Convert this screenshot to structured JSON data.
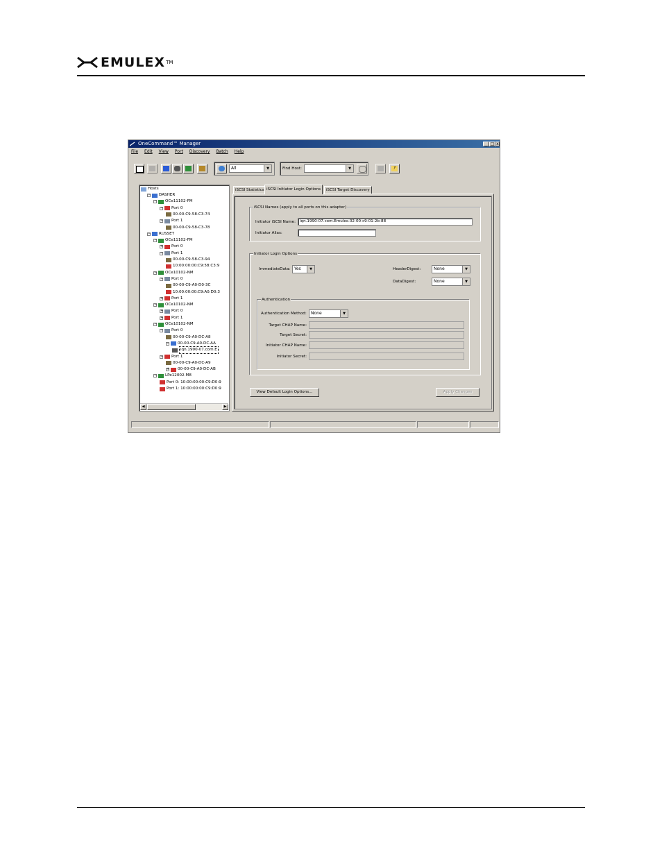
{
  "document": {
    "brand": "EMULEX",
    "brand_mark": "TM"
  },
  "window": {
    "title": "OneCommand™ Manager",
    "controls": [
      "minimize-icon",
      "maximize-icon",
      "close-icon"
    ]
  },
  "menu": [
    "File",
    "Edit",
    "View",
    "Port",
    "Discovery",
    "Batch",
    "Help"
  ],
  "toolbar": {
    "filter_value": "All",
    "find_host_label": "Find Host:",
    "find_host_value": ""
  },
  "tree": {
    "root": "Hosts",
    "nodes": [
      {
        "label": "DASHER"
      },
      {
        "label": "OCe11102-FM"
      },
      {
        "label": "Port 0"
      },
      {
        "label": "00-00-C9-58-C3-74"
      },
      {
        "label": "Port 1"
      },
      {
        "label": "00-00-C9-58-C3-78"
      },
      {
        "label": "RUSSET"
      },
      {
        "label": "OCe11102-FM"
      },
      {
        "label": "Port 0"
      },
      {
        "label": "Port 1"
      },
      {
        "label": "00-00-C9-58-C3-94"
      },
      {
        "label": "10:00:00:00:C9:58:C3:9"
      },
      {
        "label": "OCe10102-NM"
      },
      {
        "label": "Port 0"
      },
      {
        "label": "00-00-C9-A0-D0-3C"
      },
      {
        "label": "10:00:00:00:C9:A0:D0:3"
      },
      {
        "label": "Port 1"
      },
      {
        "label": "OCe10102-NM"
      },
      {
        "label": "Port 0"
      },
      {
        "label": "Port 1"
      },
      {
        "label": "OCe10102-NM"
      },
      {
        "label": "Port 0"
      },
      {
        "label": "00-00-C9-A0-DC-A8"
      },
      {
        "label": "00-00-C9-A0-DC-AA"
      },
      {
        "label": "iqn.1990-07.com.E"
      },
      {
        "label": "Port 1"
      },
      {
        "label": "00-00-C9-A0-DC-A9"
      },
      {
        "label": "00-00-C9-A0-DC-AB"
      },
      {
        "label": "LPe12002-M8"
      },
      {
        "label": "Port 0: 10:00:00:00:C9:D0:9"
      },
      {
        "label": "Port 1: 10:00:00:00:C9:D0:9"
      }
    ]
  },
  "tabs": [
    "iSCSI Statistics",
    "iSCSI Initiator Login Options",
    "iSCSI Target Discovery"
  ],
  "iscsi_names": {
    "legend": "iSCSI Names (apply to all ports on this adapter)",
    "initiator_name_label": "Initiator iSCSI Name:",
    "initiator_name_value": "iqn.1990-07.com.Emulex.02-00-c9-01-2b-88",
    "initiator_alias_label": "Initiator Alias:",
    "initiator_alias_value": ""
  },
  "login_options": {
    "legend": "Initiator Login Options",
    "immediate_data_label": "ImmediateData:",
    "immediate_data_value": "Yes",
    "header_digest_label": "HeaderDigest:",
    "header_digest_value": "None",
    "data_digest_label": "DataDigest:",
    "data_digest_value": "None"
  },
  "authentication": {
    "legend": "Authentication",
    "method_label": "Authentication Method:",
    "method_value": "None",
    "target_chap_name_label": "Target CHAP Name:",
    "target_secret_label": "Target Secret:",
    "initiator_chap_name_label": "Initiator CHAP Name:",
    "initiator_secret_label": "Initiator Secret:"
  },
  "buttons": {
    "view_defaults": "View Default Login Options...",
    "apply_changes": "Apply Changes"
  }
}
